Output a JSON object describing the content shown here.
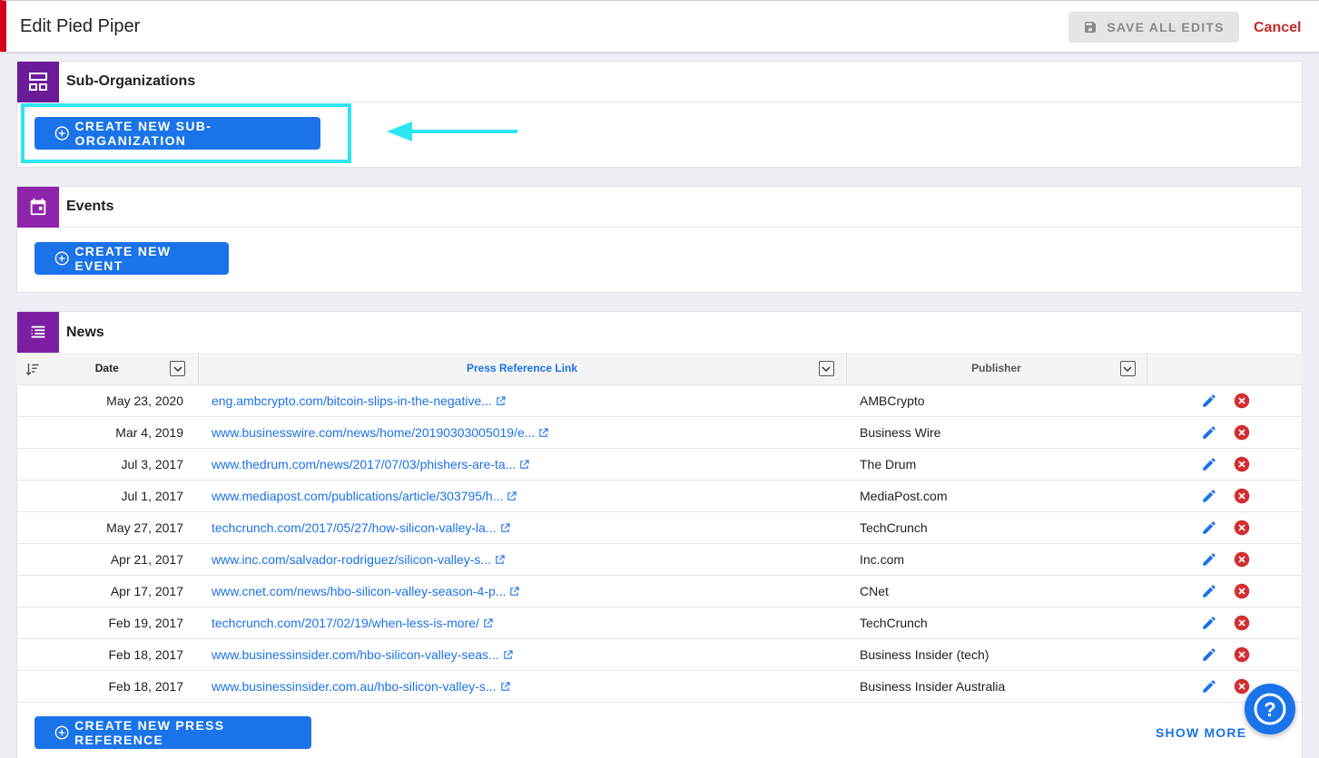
{
  "header": {
    "title": "Edit Pied Piper",
    "save_label": "SAVE ALL EDITS",
    "cancel_label": "Cancel"
  },
  "sub_organizations": {
    "title": "Sub-Organizations",
    "create_label": "CREATE NEW SUB-ORGANIZATION",
    "icon": "hierarchy-icon"
  },
  "events": {
    "title": "Events",
    "create_label": "CREATE NEW EVENT",
    "icon": "calendar-icon"
  },
  "news": {
    "title": "News",
    "icon": "news-icon",
    "columns": [
      "Date",
      "Press Reference Link",
      "Publisher"
    ],
    "rows": [
      {
        "date": "May 23, 2020",
        "link": "eng.ambcrypto.com/bitcoin-slips-in-the-negative...",
        "publisher": "AMBCrypto"
      },
      {
        "date": "Mar 4, 2019",
        "link": "www.businesswire.com/news/home/20190303005019/e...",
        "publisher": "Business Wire"
      },
      {
        "date": "Jul 3, 2017",
        "link": "www.thedrum.com/news/2017/07/03/phishers-are-ta...",
        "publisher": "The Drum"
      },
      {
        "date": "Jul 1, 2017",
        "link": "www.mediapost.com/publications/article/303795/h...",
        "publisher": "MediaPost.com"
      },
      {
        "date": "May 27, 2017",
        "link": "techcrunch.com/2017/05/27/how-silicon-valley-la...",
        "publisher": "TechCrunch"
      },
      {
        "date": "Apr 21, 2017",
        "link": "www.inc.com/salvador-rodriguez/silicon-valley-s...",
        "publisher": "Inc.com"
      },
      {
        "date": "Apr 17, 2017",
        "link": "www.cnet.com/news/hbo-silicon-valley-season-4-p...",
        "publisher": "CNet"
      },
      {
        "date": "Feb 19, 2017",
        "link": "techcrunch.com/2017/02/19/when-less-is-more/",
        "publisher": "TechCrunch"
      },
      {
        "date": "Feb 18, 2017",
        "link": "www.businessinsider.com/hbo-silicon-valley-seas...",
        "publisher": "Business Insider (tech)"
      },
      {
        "date": "Feb 18, 2017",
        "link": "www.businessinsider.com.au/hbo-silicon-valley-s...",
        "publisher": "Business Insider Australia"
      }
    ],
    "create_label": "CREATE NEW PRESS REFERENCE",
    "show_more_label": "SHOW MORE"
  },
  "colors": {
    "accent": "#1a73e8",
    "danger": "#d32f2f",
    "section_icon_bg": "#8e24aa",
    "highlight": "#2ee6f2",
    "brand_bar": "#d0021b"
  }
}
